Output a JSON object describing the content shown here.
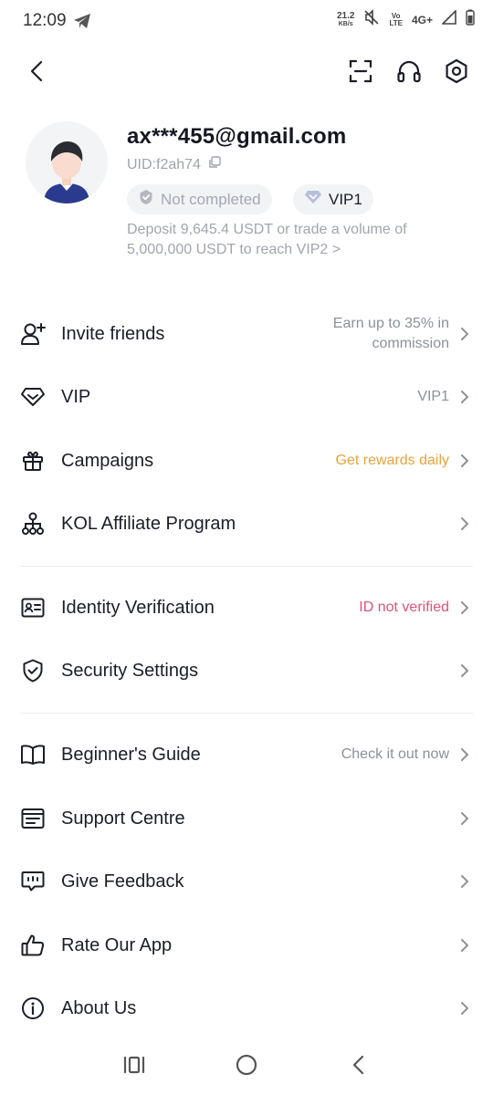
{
  "status_bar": {
    "time": "12:09",
    "speed_value": "21.2",
    "speed_unit": "KB/s",
    "volte_top": "Vo",
    "volte_bottom": "LTE",
    "network": "4G+"
  },
  "profile": {
    "email": "ax***455@gmail.com",
    "uid": "UID:f2ah74",
    "kyc_badge": "Not completed",
    "vip_badge": "VIP1",
    "vip_hint": "Deposit 9,645.4 USDT or trade a volume of 5,000,000 USDT to reach VIP2 >"
  },
  "menu": {
    "invite": {
      "label": "Invite friends",
      "value": "Earn up to 35% in commission"
    },
    "vip": {
      "label": "VIP",
      "value": "VIP1"
    },
    "campaigns": {
      "label": "Campaigns",
      "value": "Get rewards daily"
    },
    "kol": {
      "label": "KOL Affiliate Program",
      "value": ""
    },
    "identity": {
      "label": "Identity Verification",
      "value": "ID not verified"
    },
    "security": {
      "label": "Security Settings",
      "value": ""
    },
    "guide": {
      "label": "Beginner's Guide",
      "value": "Check it out now"
    },
    "support": {
      "label": "Support Centre",
      "value": ""
    },
    "feedback": {
      "label": "Give Feedback",
      "value": ""
    },
    "rate": {
      "label": "Rate Our App",
      "value": ""
    },
    "about": {
      "label": "About Us",
      "value": ""
    }
  },
  "colors": {
    "accent_orange": "#e8a33d",
    "alert_pink": "#e0517a",
    "text_primary": "#1b1d29",
    "text_secondary": "#8c909a"
  },
  "icons": {
    "back": "chevron-left-icon",
    "scan": "scan-icon",
    "support": "headset-icon",
    "settings": "hexagon-settings-icon"
  }
}
